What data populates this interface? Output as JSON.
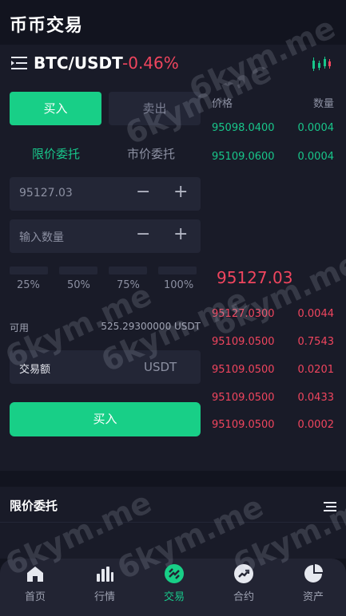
{
  "header": {
    "title": "币币交易"
  },
  "pair_bar": {
    "pair": "BTC/USDT",
    "change": "-0.46%",
    "change_color": "#f0455e"
  },
  "trade_form": {
    "side_tabs": {
      "buy": "买入",
      "sell": "卖出"
    },
    "order_types": {
      "limit": "限价委托",
      "market": "市价委托"
    },
    "price_value": "95127.03",
    "minus": "−",
    "plus": "+",
    "qty_placeholder": "输入数量",
    "percent_options": [
      "25%",
      "50%",
      "75%",
      "100%"
    ],
    "available_label": "可用",
    "available_value": "525.29300000 USDT",
    "amount_label": "交易额",
    "amount_unit": "USDT",
    "submit_label": "买入"
  },
  "order_book": {
    "header": {
      "price": "价格",
      "qty": "数量"
    },
    "bids": [
      {
        "price": "95098.0400",
        "qty": "0.0004"
      },
      {
        "price": "95109.0600",
        "qty": "0.0004"
      }
    ],
    "last_price": "95127.03",
    "asks": [
      {
        "price": "95127.0300",
        "qty": "0.0044"
      },
      {
        "price": "95109.0500",
        "qty": "0.7543"
      },
      {
        "price": "95109.0500",
        "qty": "0.0201"
      },
      {
        "price": "95109.0500",
        "qty": "0.0433"
      },
      {
        "price": "95109.0500",
        "qty": "0.0002"
      }
    ]
  },
  "orders_section": {
    "title": "限价委托"
  },
  "bottom_nav": {
    "items": [
      {
        "label": "首页",
        "icon": "home-icon"
      },
      {
        "label": "行情",
        "icon": "market-bars-icon"
      },
      {
        "label": "交易",
        "icon": "trade-icon",
        "active": true
      },
      {
        "label": "合约",
        "icon": "contract-trend-icon"
      },
      {
        "label": "资产",
        "icon": "assets-pie-icon"
      }
    ]
  },
  "watermark": "6kym.me",
  "colors": {
    "accent_green": "#18cf87",
    "down_red": "#f0455e",
    "background": "#12141f",
    "panel": "#191b28"
  }
}
